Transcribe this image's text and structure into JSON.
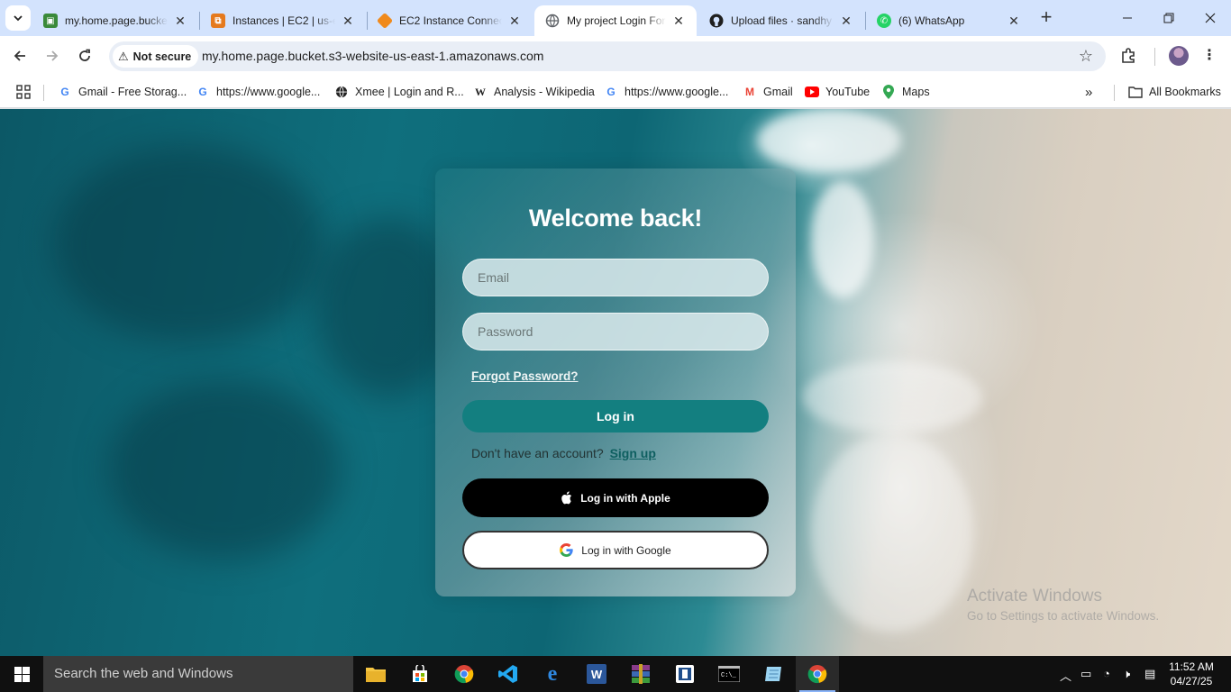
{
  "browser": {
    "tabs": [
      {
        "title": "my.home.page.bucke",
        "favicon": "bucket-favicon",
        "color": "#3a8a3a",
        "active": false
      },
      {
        "title": "Instances | EC2 | us-e",
        "favicon": "aws-favicon",
        "color": "#e57a1e",
        "active": false
      },
      {
        "title": "EC2 Instance Connect",
        "favicon": "ec2-favicon",
        "color": "#f08a1c",
        "active": false
      },
      {
        "title": "My project Login For",
        "favicon": "globe-favicon",
        "color": "#5f6368",
        "active": true
      },
      {
        "title": "Upload files · sandhy",
        "favicon": "github-favicon",
        "color": "#1f1f1f",
        "active": false
      },
      {
        "title": "(6) WhatsApp",
        "favicon": "whatsapp-favicon",
        "color": "#25d366",
        "active": false
      }
    ],
    "security_label": "Not secure",
    "url": "my.home.page.bucket.s3-website-us-east-1.amazonaws.com",
    "bookmarks": [
      {
        "label": "Gmail - Free Storag...",
        "icon": "google-icon"
      },
      {
        "label": "https://www.google...",
        "icon": "google-icon"
      },
      {
        "label": "Xmee | Login and R...",
        "icon": "globe-icon"
      },
      {
        "label": "Analysis - Wikipedia",
        "icon": "wikipedia-icon"
      },
      {
        "label": "https://www.google...",
        "icon": "google-icon"
      },
      {
        "label": "Gmail",
        "icon": "gmail-icon"
      },
      {
        "label": "YouTube",
        "icon": "youtube-icon"
      },
      {
        "label": "Maps",
        "icon": "maps-icon"
      }
    ],
    "all_bookmarks_label": "All Bookmarks"
  },
  "login": {
    "title": "Welcome back!",
    "email_placeholder": "Email",
    "password_placeholder": "Password",
    "forgot_label": "Forgot Password?",
    "login_label": "Log in",
    "no_account_text": "Don't have an account?",
    "signup_label": "Sign up",
    "apple_label": "Log in with Apple",
    "google_label": "Log in with Google",
    "accent_color": "#137f80"
  },
  "watermark": {
    "line1": "Activate Windows",
    "line2": "Go to Settings to activate Windows."
  },
  "taskbar": {
    "search_placeholder": "Search the web and Windows",
    "time": "11:52 AM",
    "date": "04/27/25"
  }
}
